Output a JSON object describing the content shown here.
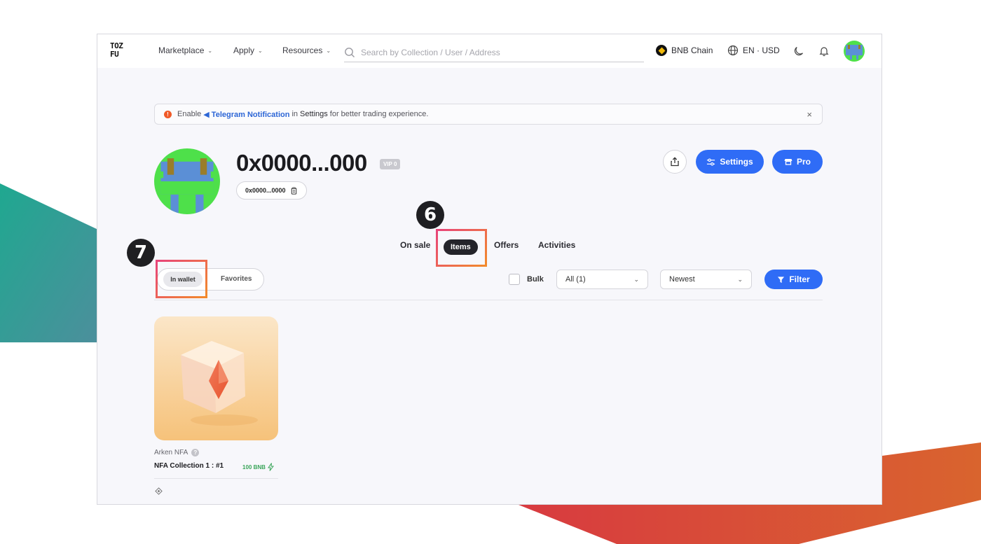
{
  "nav": {
    "logo_line1": "TOZ",
    "logo_line2": "FU",
    "marketplace": "Marketplace",
    "apply": "Apply",
    "resources": "Resources",
    "search_placeholder": "Search by Collection / User / Address",
    "chain": "BNB Chain",
    "language": "EN · USD"
  },
  "banner": {
    "enable": "Enable",
    "telegram": "Telegram Notification",
    "in": "in",
    "settings": "Settings",
    "rest": "for better trading experience.",
    "close": "×"
  },
  "profile": {
    "address": "0x0000...000",
    "vip": "VIP 0",
    "short_address": "0x0000...0000",
    "settings_label": "Settings",
    "pro_label": "Pro"
  },
  "tabs": {
    "on_sale": "On sale",
    "items": "Items",
    "offers": "Offers",
    "activities": "Activities"
  },
  "steps": {
    "six": "6",
    "seven": "7"
  },
  "subtabs": {
    "in_wallet": "In wallet",
    "favorites": "Favorites"
  },
  "toolbar": {
    "bulk": "Bulk",
    "all_select": "All (1)",
    "sort_select": "Newest",
    "filter": "Filter"
  },
  "card": {
    "collection": "Arken NFA",
    "name": "NFA Collection 1 : #1",
    "price": "100 BNB"
  },
  "colors": {
    "accent": "#2f6cf6",
    "highlight_start": "#e8447a",
    "highlight_end": "#f28a2b",
    "price_green": "#3aa55a"
  }
}
